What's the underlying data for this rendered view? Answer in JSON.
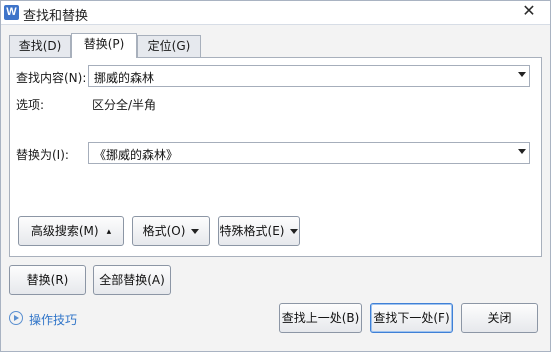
{
  "window": {
    "title": "查找和替换",
    "app_icon": "W",
    "close_glyph": "✕"
  },
  "tabs": [
    {
      "label": "查找(D)",
      "active": false
    },
    {
      "label": "替换(P)",
      "active": true
    },
    {
      "label": "定位(G)",
      "active": false
    }
  ],
  "find": {
    "label": "查找内容(N):",
    "value": "挪威的森林"
  },
  "options": {
    "label": "选项:",
    "value": "区分全/半角"
  },
  "replace": {
    "label": "替换为(I):",
    "value": "《挪威的森林》"
  },
  "panel_buttons": {
    "advanced_search": "高级搜索(M)",
    "format": "格式(O)",
    "special_format": "特殊格式(E)"
  },
  "action_buttons": {
    "replace": "替换(R)",
    "replace_all": "全部替换(A)",
    "find_prev": "查找上一处(B)",
    "find_next": "查找下一处(F)",
    "close": "关闭"
  },
  "tips": {
    "label": "操作技巧"
  },
  "colors": {
    "accent": "#2f74c8",
    "focus_border": "#3f80d6"
  }
}
